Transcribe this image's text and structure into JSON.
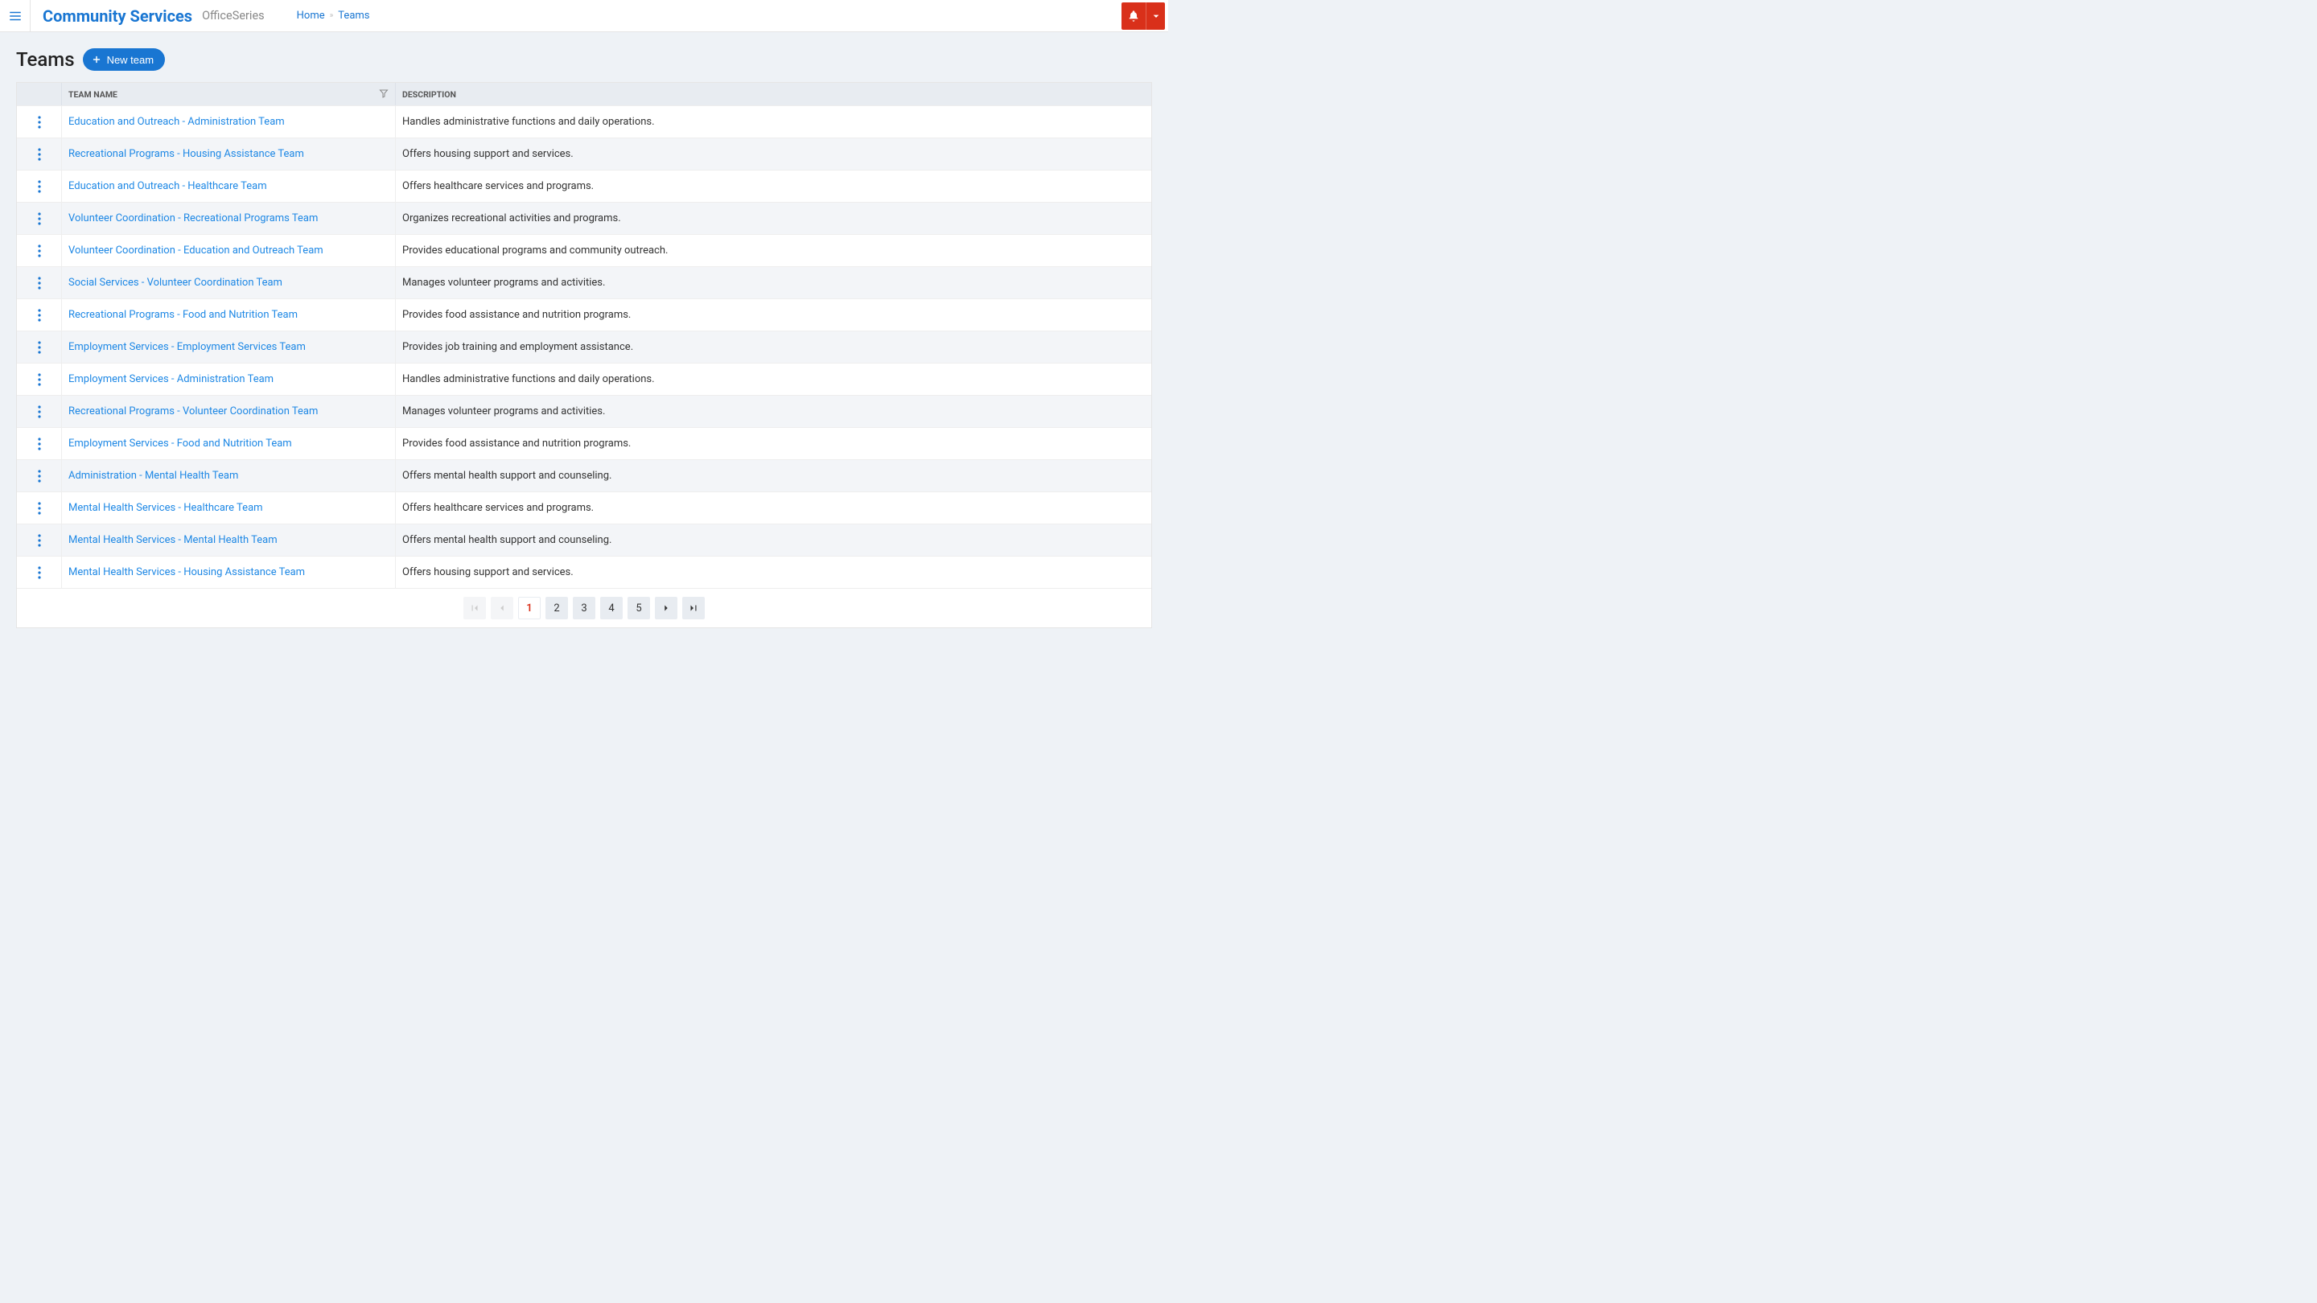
{
  "header": {
    "brand": "Community Services",
    "brand_sub": "OfficeSeries"
  },
  "breadcrumb": {
    "home": "Home",
    "current": "Teams"
  },
  "page": {
    "title": "Teams",
    "new_button": "New team"
  },
  "table": {
    "columns": {
      "name": "TEAM NAME",
      "description": "DESCRIPTION"
    },
    "rows": [
      {
        "name": "Education and Outreach - Administration Team",
        "desc": "Handles administrative functions and daily operations."
      },
      {
        "name": "Recreational Programs - Housing Assistance Team",
        "desc": "Offers housing support and services."
      },
      {
        "name": "Education and Outreach - Healthcare Team",
        "desc": "Offers healthcare services and programs."
      },
      {
        "name": "Volunteer Coordination - Recreational Programs Team",
        "desc": "Organizes recreational activities and programs."
      },
      {
        "name": "Volunteer Coordination - Education and Outreach Team",
        "desc": "Provides educational programs and community outreach."
      },
      {
        "name": "Social Services - Volunteer Coordination Team",
        "desc": "Manages volunteer programs and activities."
      },
      {
        "name": "Recreational Programs - Food and Nutrition Team",
        "desc": "Provides food assistance and nutrition programs."
      },
      {
        "name": "Employment Services - Employment Services Team",
        "desc": "Provides job training and employment assistance."
      },
      {
        "name": "Employment Services - Administration Team",
        "desc": "Handles administrative functions and daily operations."
      },
      {
        "name": "Recreational Programs - Volunteer Coordination Team",
        "desc": "Manages volunteer programs and activities."
      },
      {
        "name": "Employment Services - Food and Nutrition Team",
        "desc": "Provides food assistance and nutrition programs."
      },
      {
        "name": "Administration - Mental Health Team",
        "desc": "Offers mental health support and counseling."
      },
      {
        "name": "Mental Health Services - Healthcare Team",
        "desc": "Offers healthcare services and programs."
      },
      {
        "name": "Mental Health Services - Mental Health Team",
        "desc": "Offers mental health support and counseling."
      },
      {
        "name": "Mental Health Services - Housing Assistance Team",
        "desc": "Offers housing support and services."
      }
    ]
  },
  "pagination": {
    "pages": [
      "1",
      "2",
      "3",
      "4",
      "5"
    ],
    "current": "1"
  }
}
